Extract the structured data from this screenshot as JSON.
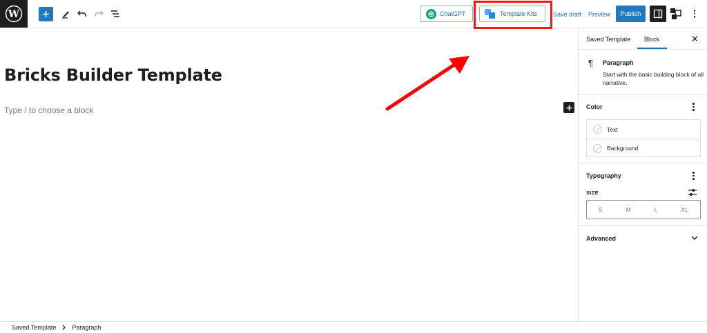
{
  "toolbar": {
    "chatgpt_label": "ChatGPT",
    "template_kits_label": "Template Kits",
    "save_draft_label": "Save draft",
    "preview_label": "Preview",
    "publish_label": "Publish"
  },
  "editor": {
    "title": "Bricks Builder Template",
    "placeholder": "Type / to choose a block"
  },
  "sidebar": {
    "tabs": [
      {
        "label": "Saved Template"
      },
      {
        "label": "Block",
        "active": true
      }
    ],
    "block": {
      "name": "Paragraph",
      "description": "Start with the basic building block of all narrative."
    },
    "color": {
      "title": "Color",
      "options": [
        "Text",
        "Background"
      ]
    },
    "typography": {
      "title": "Typography",
      "size_label": "SIZE",
      "sizes": [
        "S",
        "M",
        "L",
        "XL"
      ]
    },
    "advanced": {
      "title": "Advanced"
    }
  },
  "breadcrumb": {
    "items": [
      "Saved Template",
      "Paragraph"
    ]
  },
  "colors": {
    "accent": "#2271b1",
    "primary_button": "#1f7bbd",
    "highlight": "#ff1414",
    "dark": "#1e1e1e"
  }
}
